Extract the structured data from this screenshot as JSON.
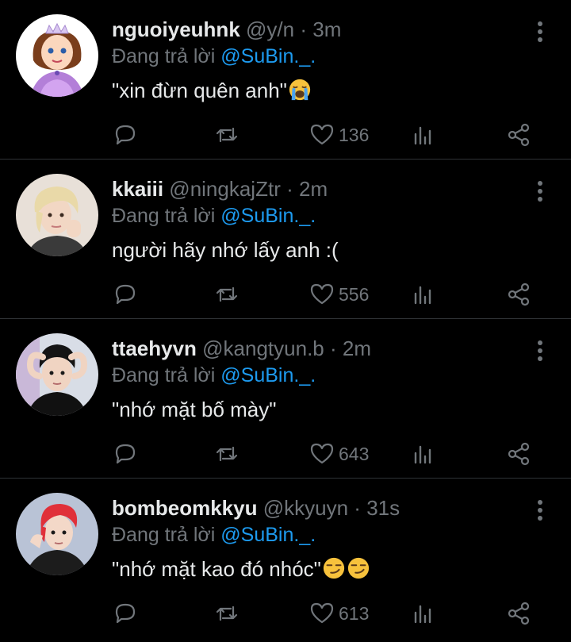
{
  "tweets": [
    {
      "username": "nguoiyeuhnk",
      "handle": "@y/n",
      "dot": "·",
      "time": "3m",
      "reply_prefix": "Đang trả lời",
      "reply_mention": "@SuBin._.",
      "text": "\"xin đừn quên anh\"",
      "emoji": [
        "loudly-crying-face"
      ],
      "likes": "136",
      "avatar": "princess-cartoon-avatar"
    },
    {
      "username": "kkaiii",
      "handle": "@ningkajZtr",
      "dot": "·",
      "time": "2m",
      "reply_prefix": "Đang trả lời",
      "reply_mention": "@SuBin._.",
      "text": "người hãy nhớ lấy anh :(",
      "emoji": [],
      "likes": "556",
      "avatar": "blonde-person-avatar"
    },
    {
      "username": "ttaehyvn",
      "handle": "@kangtyun.b",
      "dot": "·",
      "time": "2m",
      "reply_prefix": "Đang trả lời",
      "reply_mention": "@SuBin._.",
      "text": "\"nhớ mặt bố mày\"",
      "emoji": [],
      "likes": "643",
      "avatar": "dark-hair-person-avatar"
    },
    {
      "username": "bombeomkkyu",
      "handle": "@kkyuyn",
      "dot": "·",
      "time": "31s",
      "reply_prefix": "Đang trả lời",
      "reply_mention": "@SuBin._.",
      "text": "\"nhớ mặt kao đó nhóc\"",
      "emoji": [
        "smirking-face",
        "smirking-face"
      ],
      "likes": "613",
      "avatar": "red-hair-person-avatar"
    }
  ],
  "colors": {
    "background": "#000000",
    "text": "#e7e9ea",
    "secondary": "#71767b",
    "mention": "#1d9bf0",
    "divider": "#2f3336"
  },
  "icons": {
    "reply": "reply-icon",
    "retweet": "retweet-icon",
    "like": "heart-icon",
    "stats": "stats-icon",
    "share": "share-icon",
    "more": "more-vertical-icon"
  }
}
